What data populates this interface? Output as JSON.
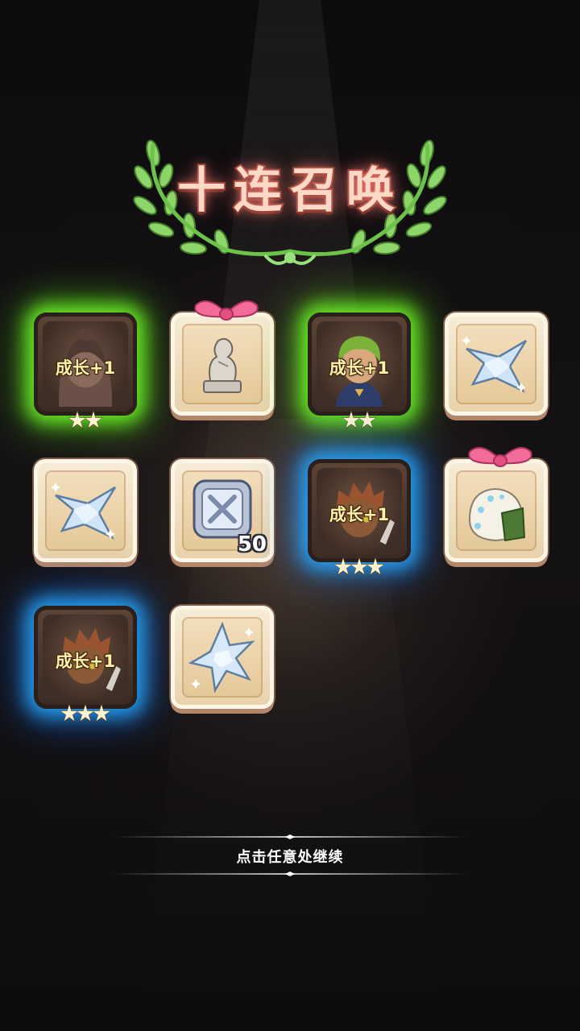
{
  "title": "十连召唤",
  "continue_prompt": "点击任意处继续",
  "colors": {
    "rarity_green_glow": "#6eff28",
    "rarity_blue_glow": "#28aaff",
    "title_glow": "#ff8278"
  },
  "results": [
    {
      "kind": "hero",
      "label": "成长+1",
      "stars": 2,
      "rarity": "green",
      "icon": "hooded-girl-portrait-icon"
    },
    {
      "kind": "item",
      "icon": "stone-statue-icon",
      "bow": true
    },
    {
      "kind": "hero",
      "label": "成长+1",
      "stars": 2,
      "rarity": "green",
      "icon": "green-haired-boy-portrait-icon"
    },
    {
      "kind": "item",
      "icon": "crystal-shuriken-icon"
    },
    {
      "kind": "item",
      "icon": "crystal-shuriken-icon"
    },
    {
      "kind": "item",
      "icon": "silver-frame-token-icon",
      "quantity": "50"
    },
    {
      "kind": "hero",
      "label": "成长+1",
      "stars": 3,
      "rarity": "blue",
      "icon": "spiky-haired-boy-portrait-icon"
    },
    {
      "kind": "item",
      "icon": "rice-ball-icon",
      "bow": true
    },
    {
      "kind": "hero",
      "label": "成长+1",
      "stars": 3,
      "rarity": "blue",
      "icon": "spiky-haired-boy-portrait-icon"
    },
    {
      "kind": "item",
      "icon": "crystal-star-icon"
    }
  ]
}
